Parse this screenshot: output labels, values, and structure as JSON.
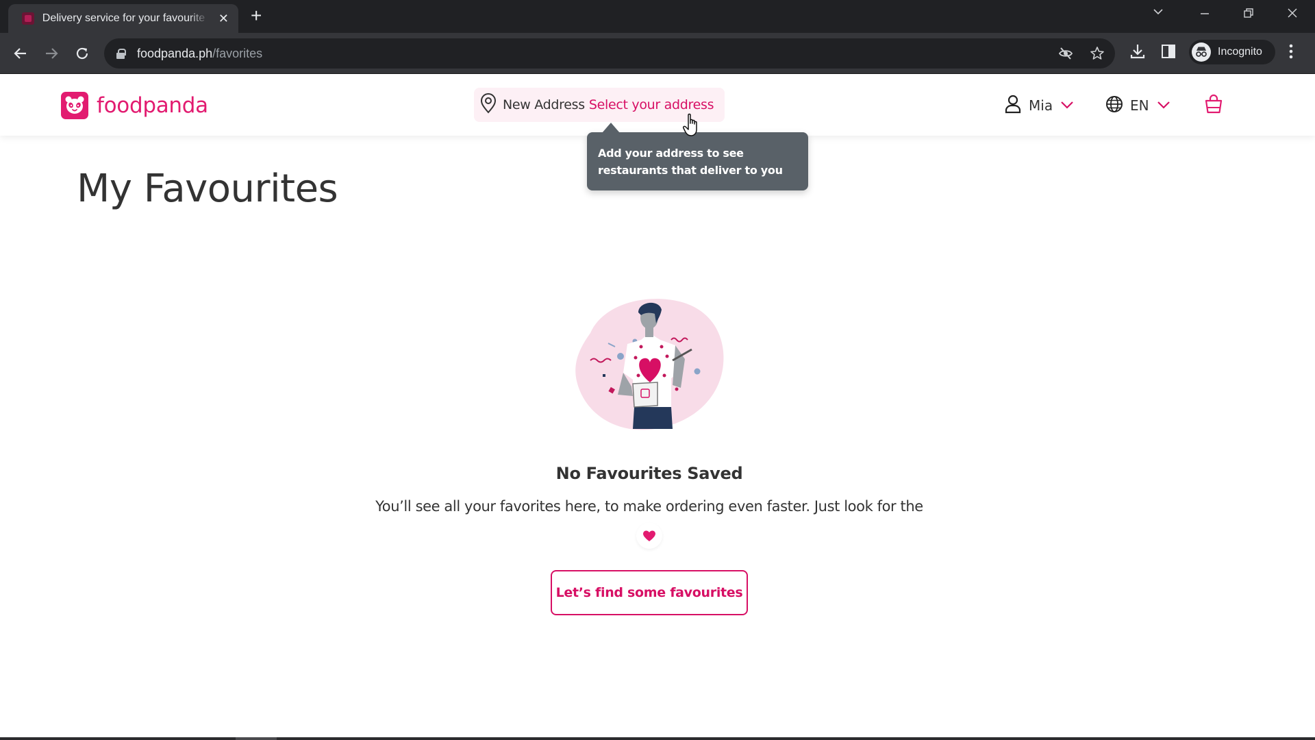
{
  "browser": {
    "tab_title": "Delivery service for your favourite restaurants",
    "tab_close": "✕",
    "new_tab": "+",
    "url_host": "foodpanda.ph",
    "url_path": "/favorites",
    "profile_label": "Incognito",
    "window_controls": {
      "tab_search": "⌄",
      "minimize": "—",
      "restore": "❐",
      "close": "✕"
    }
  },
  "header": {
    "brand": "foodpanda",
    "address_label": "New Address",
    "address_action": "Select your address",
    "user_name": "Mia",
    "language": "EN",
    "cart_icon": "shopping-bag-icon"
  },
  "tooltip": {
    "text": "Add your address to see restaurants that deliver to you"
  },
  "main": {
    "title": "My Favourites",
    "empty_title": "No Favourites Saved",
    "empty_text": "You’ll see all your favorites here, to make ordering even faster. Just look for the",
    "cta_label": "Let’s find some favourites"
  },
  "colors": {
    "brand": "#e21b70",
    "brand_text": "#d70f64",
    "tooltip_bg": "#596168",
    "address_pill_bg": "#fdf0f5",
    "illustration_bg": "#f8dce8"
  }
}
